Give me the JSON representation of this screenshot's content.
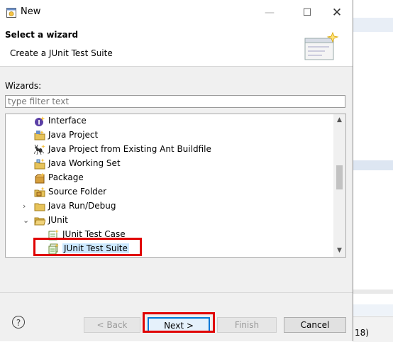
{
  "window": {
    "title": "New"
  },
  "header": {
    "title": "Select a wizard",
    "description": "Create a JUnit Test Suite"
  },
  "wizards_label": "Wizards:",
  "filter": {
    "placeholder": "type filter text",
    "value": ""
  },
  "tree": {
    "items": [
      {
        "label": "Interface",
        "icon": "interface-icon"
      },
      {
        "label": "Java Project",
        "icon": "java-project-icon"
      },
      {
        "label": "Java Project from Existing Ant Buildfile",
        "icon": "ant-icon"
      },
      {
        "label": "Java Working Set",
        "icon": "working-set-icon"
      },
      {
        "label": "Package",
        "icon": "package-icon"
      },
      {
        "label": "Source Folder",
        "icon": "source-folder-icon"
      },
      {
        "label": "Java Run/Debug",
        "icon": "folder-icon",
        "expanded": false
      },
      {
        "label": "JUnit",
        "icon": "folder-open-icon",
        "expanded": true
      },
      {
        "label": "JUnit Test Case",
        "icon": "junit-test-case-icon"
      },
      {
        "label": "JUnit Test Suite",
        "icon": "junit-test-suite-icon",
        "selected": true
      }
    ],
    "chevron_collapsed": "›",
    "chevron_expanded": "⌄"
  },
  "buttons": {
    "help": "?",
    "back": "< Back",
    "next": "Next >",
    "finish": "Finish",
    "cancel": "Cancel"
  },
  "window_controls": {
    "minimize": "—",
    "maximize": "☐",
    "close": "✕"
  },
  "background": {
    "status_text": "18)"
  },
  "colors": {
    "highlight": "#e00000",
    "selection": "#cce8ff",
    "default_button_border": "#0078d7"
  }
}
